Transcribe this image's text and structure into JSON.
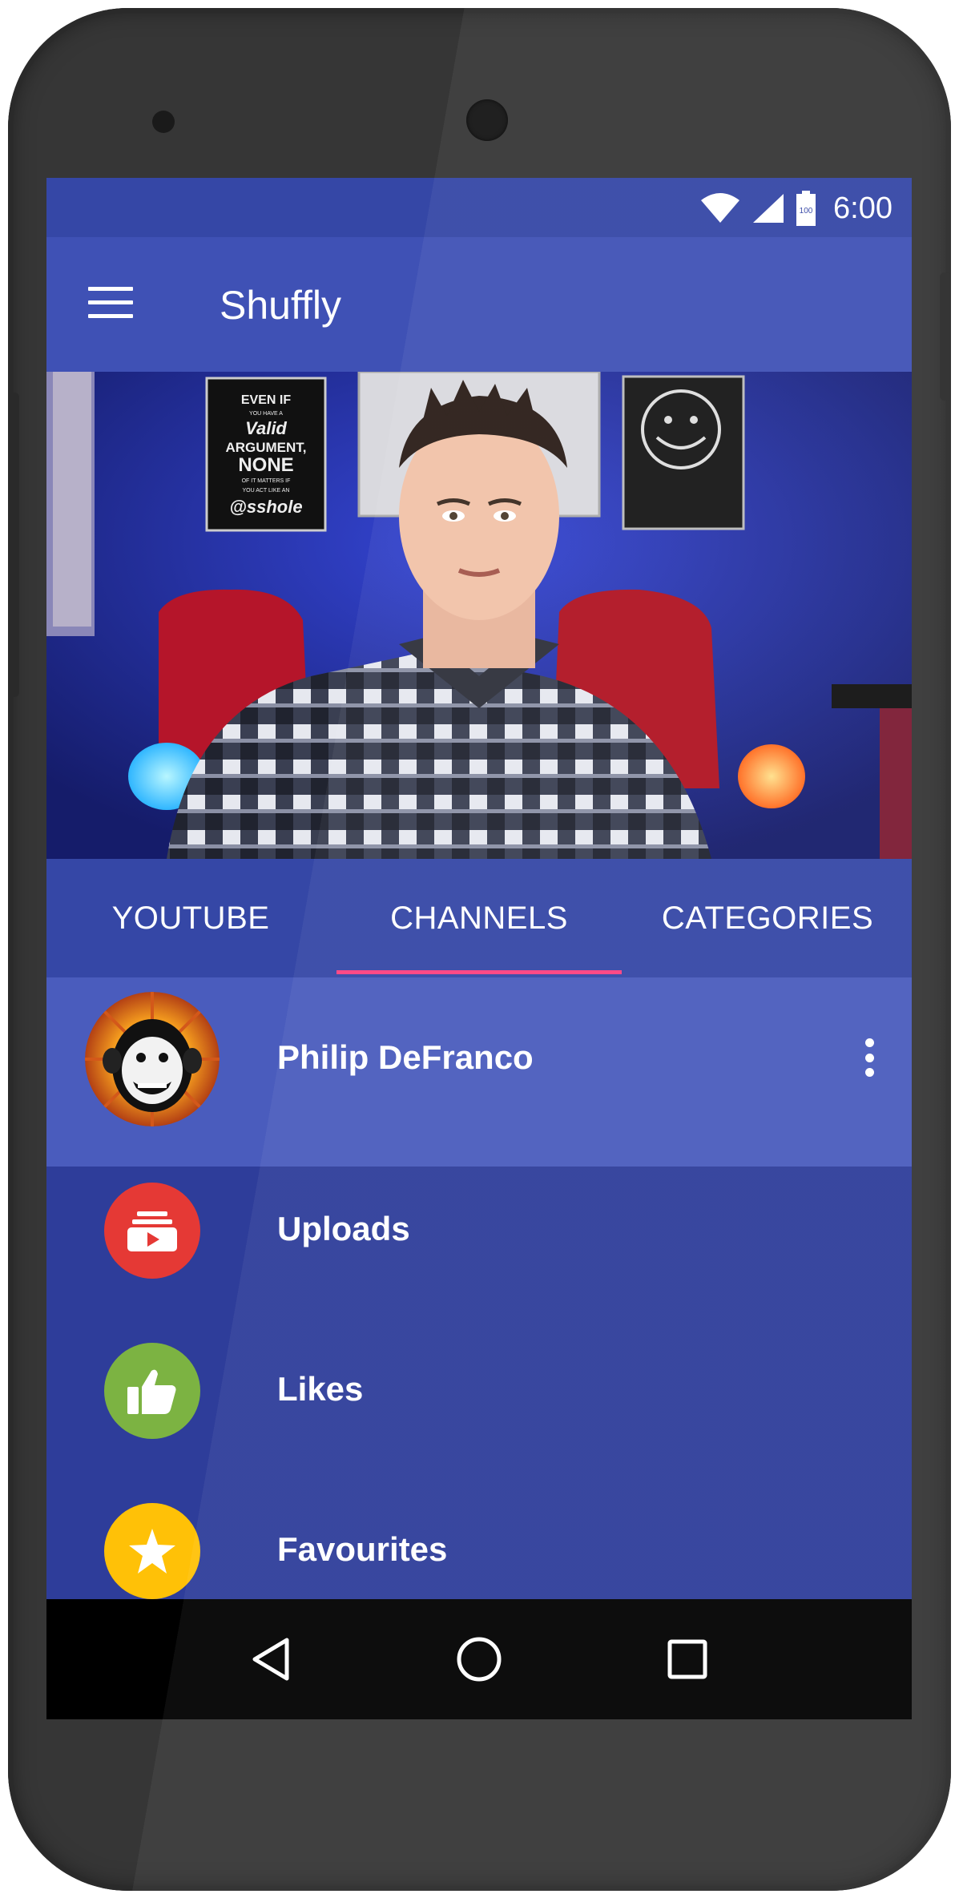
{
  "status_bar": {
    "battery": "100",
    "time": "6:00"
  },
  "app_bar": {
    "title": "Shuffly",
    "menu_icon": "hamburger-menu-icon"
  },
  "hero": {
    "poster_text": [
      "EVEN IF",
      "YOU HAVE A",
      "Valid",
      "ARGUMENT,",
      "NONE",
      "OF IT MATTERS IF",
      "YOU ACT LIKE AN",
      "@sshole"
    ]
  },
  "tabs": [
    {
      "label": "YOUTUBE",
      "active": false
    },
    {
      "label": "CHANNELS",
      "active": true
    },
    {
      "label": "CATEGORIES",
      "active": false
    }
  ],
  "channel": {
    "name": "Philip DeFranco",
    "menu_icon": "more-vert-icon"
  },
  "list": [
    {
      "label": "Uploads",
      "icon": "uploads-icon",
      "color": "#e53935"
    },
    {
      "label": "Likes",
      "icon": "thumb-up-icon",
      "color": "#7cb342"
    },
    {
      "label": "Favourites",
      "icon": "star-icon",
      "color": "#ffc107"
    }
  ],
  "colors": {
    "primary": "#3f51b5",
    "primary_dark": "#3547a6",
    "accent": "#ff4081",
    "list_bg": "#2e3d9a",
    "channel_row_bg": "#4a5cbd"
  },
  "nav": {
    "back_icon": "back-triangle-icon",
    "home_icon": "home-circle-icon",
    "recents_icon": "recents-square-icon"
  }
}
